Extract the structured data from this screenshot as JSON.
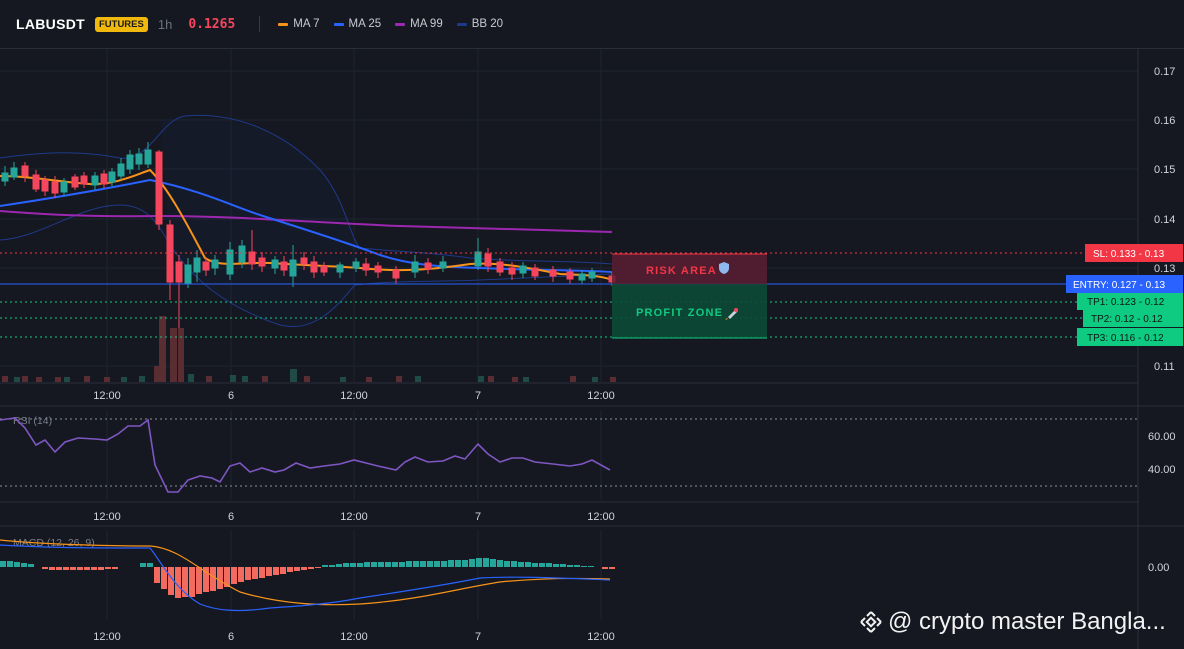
{
  "header": {
    "symbol": "LABUSDT",
    "market": "FUTURES",
    "timeframe": "1h",
    "last_price": "0.1265",
    "indicators": [
      {
        "label": "MA 7",
        "color": "#f7931a"
      },
      {
        "label": "MA 25",
        "color": "#2962ff"
      },
      {
        "label": "MA 99",
        "color": "#9c27b0"
      },
      {
        "label": "BB 20",
        "color": "#1e3a8a"
      }
    ]
  },
  "price_axis": [
    "0.17",
    "0.16",
    "0.15",
    "0.14",
    "0.13",
    "0.11"
  ],
  "time_axis": [
    "12:00",
    "6",
    "12:00",
    "7",
    "12:00"
  ],
  "zones": {
    "risk": "RISK AREA",
    "profit": "PROFIT ZONE"
  },
  "levels": {
    "sl": "SL: 0.133 - 0.13",
    "entry": "ENTRY: 0.127 - 0.13",
    "tp1": "TP1: 0.123 - 0.12",
    "tp2": "TP2: 0.12 - 0.12",
    "tp3": "TP3: 0.116 - 0.12"
  },
  "rsi": {
    "title": "RSI (14)",
    "axis": [
      "60.00",
      "40.00"
    ],
    "color": "#7e57c2"
  },
  "macd": {
    "title": "MACD (12, 26, 9)",
    "axis": [
      "0.00"
    ]
  },
  "colors": {
    "up": "#26a69a",
    "up_bright": "#2ebd85",
    "down": "#f6465d",
    "sl": "#f23645",
    "entry": "#2962ff",
    "tp": "#0ecb81"
  },
  "watermark": "@ crypto master Bangla..."
}
